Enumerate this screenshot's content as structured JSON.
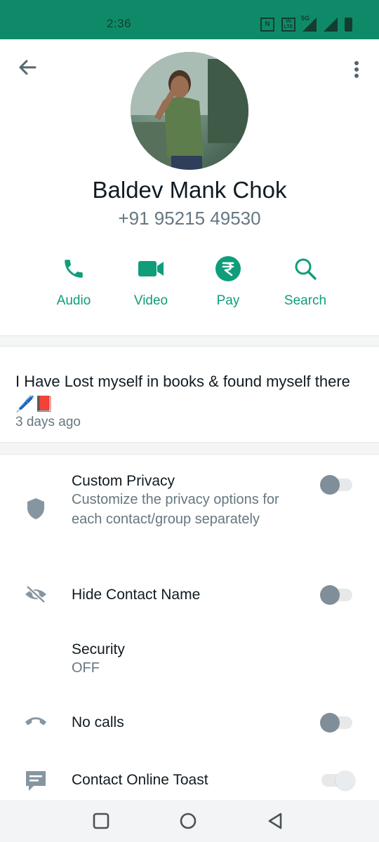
{
  "status_bar": {
    "time": "2:36",
    "icons": [
      "nfc-icon",
      "volte-icon",
      "signal-5g-icon",
      "signal-icon",
      "battery-icon"
    ],
    "nfc_label": "N",
    "volte_label": "Vo LTE",
    "network_label": "5G"
  },
  "header": {
    "contact_name": "Baldev Mank Chok",
    "phone": "+91 95215 49530"
  },
  "actions": [
    {
      "label": "Audio",
      "icon": "phone-icon"
    },
    {
      "label": "Video",
      "icon": "video-camera-icon"
    },
    {
      "label": "Pay",
      "icon": "rupee-icon"
    },
    {
      "label": "Search",
      "icon": "search-icon"
    }
  ],
  "about": {
    "text": "I Have Lost myself in books & found myself there🖊️📕",
    "time": "3 days ago"
  },
  "settings": {
    "custom_privacy": {
      "title": "Custom Privacy",
      "subtitle": "Customize the privacy options for each contact/group separately",
      "enabled": false
    },
    "hide_contact_name": {
      "title": "Hide Contact Name",
      "enabled": false
    },
    "security": {
      "title": "Security",
      "value": "OFF"
    },
    "no_calls": {
      "title": "No calls",
      "enabled": false
    },
    "contact_online_toast": {
      "title": "Contact Online Toast",
      "enabled": false
    }
  },
  "colors": {
    "accent": "#0f9d7a",
    "status_bar": "#0f8a68",
    "secondary_text": "#667781",
    "primary_text": "#111b21"
  }
}
